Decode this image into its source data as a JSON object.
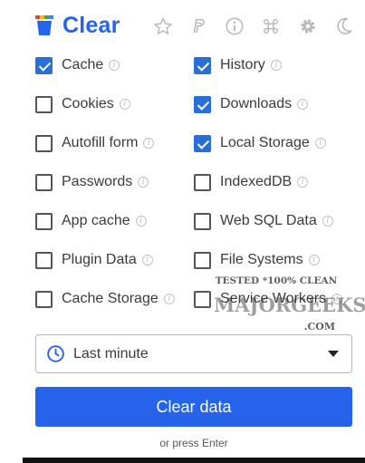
{
  "header": {
    "title": "Clear",
    "icons": [
      "star-icon",
      "paypal-icon",
      "info-icon",
      "command-icon",
      "gear-icon",
      "moon-icon"
    ]
  },
  "options": [
    {
      "label": "Cache",
      "checked": true
    },
    {
      "label": "History",
      "checked": true
    },
    {
      "label": "Cookies",
      "checked": false
    },
    {
      "label": "Downloads",
      "checked": true
    },
    {
      "label": "Autofill form",
      "checked": false
    },
    {
      "label": "Local Storage",
      "checked": true
    },
    {
      "label": "Passwords",
      "checked": false
    },
    {
      "label": "IndexedDB",
      "checked": false
    },
    {
      "label": "App cache",
      "checked": false
    },
    {
      "label": "Web SQL Data",
      "checked": false
    },
    {
      "label": "Plugin Data",
      "checked": false
    },
    {
      "label": "File Systems",
      "checked": false
    },
    {
      "label": "Cache Storage",
      "checked": false
    },
    {
      "label": "Service Workers",
      "checked": false
    }
  ],
  "time_range": {
    "selected": "Last minute"
  },
  "action": {
    "button_label": "Clear data",
    "hint": "or press Enter"
  },
  "watermark": {
    "line1": "TESTED *100% CLEAN",
    "line2": "MAJORGEEKS",
    "line3": ".COM"
  },
  "colors": {
    "accent": "#2563eb",
    "checkbox": "#2a6ed8"
  }
}
